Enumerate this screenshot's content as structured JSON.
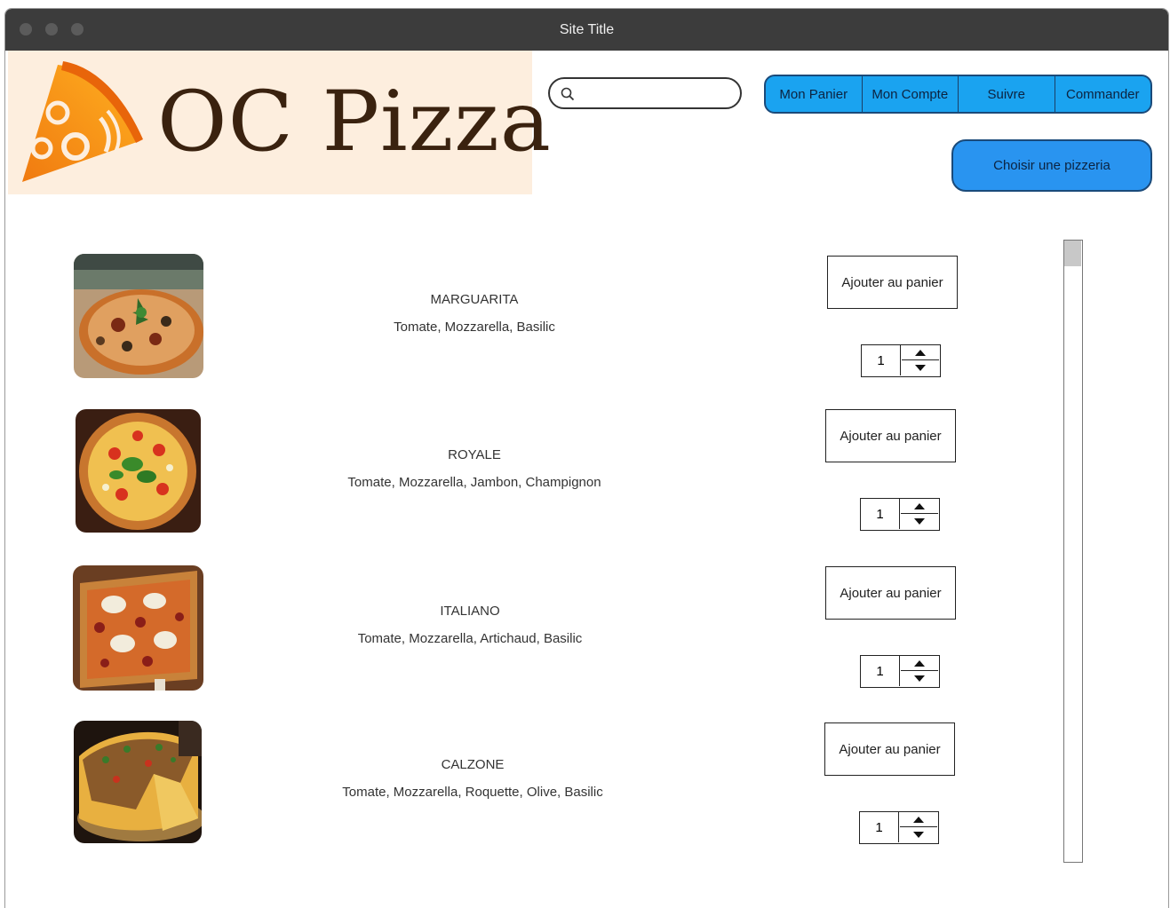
{
  "window": {
    "title": "Site Title"
  },
  "logo": {
    "text": "OC Pizza"
  },
  "search": {
    "placeholder": "",
    "value": ""
  },
  "nav": {
    "items": [
      {
        "label": "Mon Panier"
      },
      {
        "label": "Mon Compte"
      },
      {
        "label": "Suivre"
      },
      {
        "label": "Commander"
      }
    ],
    "choose_label": "Choisir une pizzeria"
  },
  "colors": {
    "nav_bg": "#1aa3f0",
    "choose_bg": "#2994f0",
    "logo_bg": "#fdeede",
    "logo_text": "#3a220f",
    "titlebar": "#3c3c3c"
  },
  "pizzas": [
    {
      "name": "MARGUARITA",
      "ingredients": "Tomate, Mozzarella, Basilic",
      "add_label": "Ajouter au panier",
      "quantity": "1"
    },
    {
      "name": "ROYALE",
      "ingredients": "Tomate, Mozzarella, Jambon, Champignon",
      "add_label": "Ajouter au panier",
      "quantity": "1"
    },
    {
      "name": "ITALIANO",
      "ingredients": "Tomate, Mozzarella, Artichaud,  Basilic",
      "add_label": "Ajouter au panier",
      "quantity": "1"
    },
    {
      "name": "CALZONE",
      "ingredients": "Tomate, Mozzarella, Roquette, Olive, Basilic",
      "add_label": "Ajouter au panier",
      "quantity": "1"
    }
  ]
}
